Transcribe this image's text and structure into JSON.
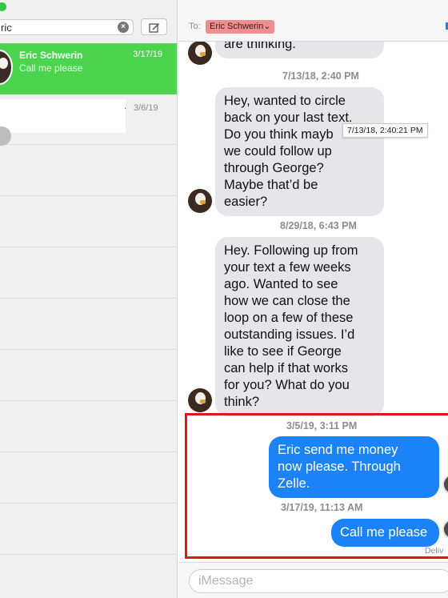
{
  "sidebar": {
    "search": {
      "value": "ric",
      "clear_icon": "×"
    },
    "compose_icon": "compose-icon",
    "conversations": [
      {
        "name": "Eric Schwerin",
        "preview": "Call me please",
        "date": "3/17/19",
        "selected": true
      },
      {
        "name": "",
        "preview": "",
        "date": "3/6/19",
        "dot": "."
      }
    ]
  },
  "chat": {
    "to_label": "To:",
    "recipient": "Eric Schwerin",
    "recipient_chevron": "⌄",
    "messages": [
      {
        "direction": "in",
        "text": "are thinking."
      },
      {
        "type": "timestamp",
        "text": "7/13/18, 2:40 PM"
      },
      {
        "direction": "in",
        "text": "Hey, wanted to circle\nback on your last text.\n Do you think mayb\nwe could follow up\nthrough George?\n Maybe that’d be\neasier?"
      },
      {
        "type": "timestamp",
        "text": "8/29/18, 6:43 PM"
      },
      {
        "direction": "in",
        "text": "Hey.  Following up from\nyour text a few weeks\nago.  Wanted to see\nhow we can close the\nloop on a few of these\noutstanding issues. I’d\n like to see if George\ncan help if that works\nfor you? What do you\nthink?"
      },
      {
        "type": "timestamp",
        "text": "3/5/19, 3:11 PM"
      },
      {
        "direction": "out",
        "text": "Eric send me money\nnow please. Through\nZelle."
      },
      {
        "type": "timestamp",
        "text": "3/17/19, 11:13 AM"
      },
      {
        "direction": "out",
        "text": "Call me please"
      }
    ],
    "tooltip": "7/13/18, 2:40:21 PM",
    "delivered": "Deliv",
    "input_placeholder": "iMessage"
  },
  "colors": {
    "selected_row": "#4cd44e",
    "outgoing_bubble": "#1b83f7",
    "incoming_bubble": "#e5e5ea",
    "recipient_chip": "#ef8e8e",
    "highlight_box": "#e11616"
  }
}
